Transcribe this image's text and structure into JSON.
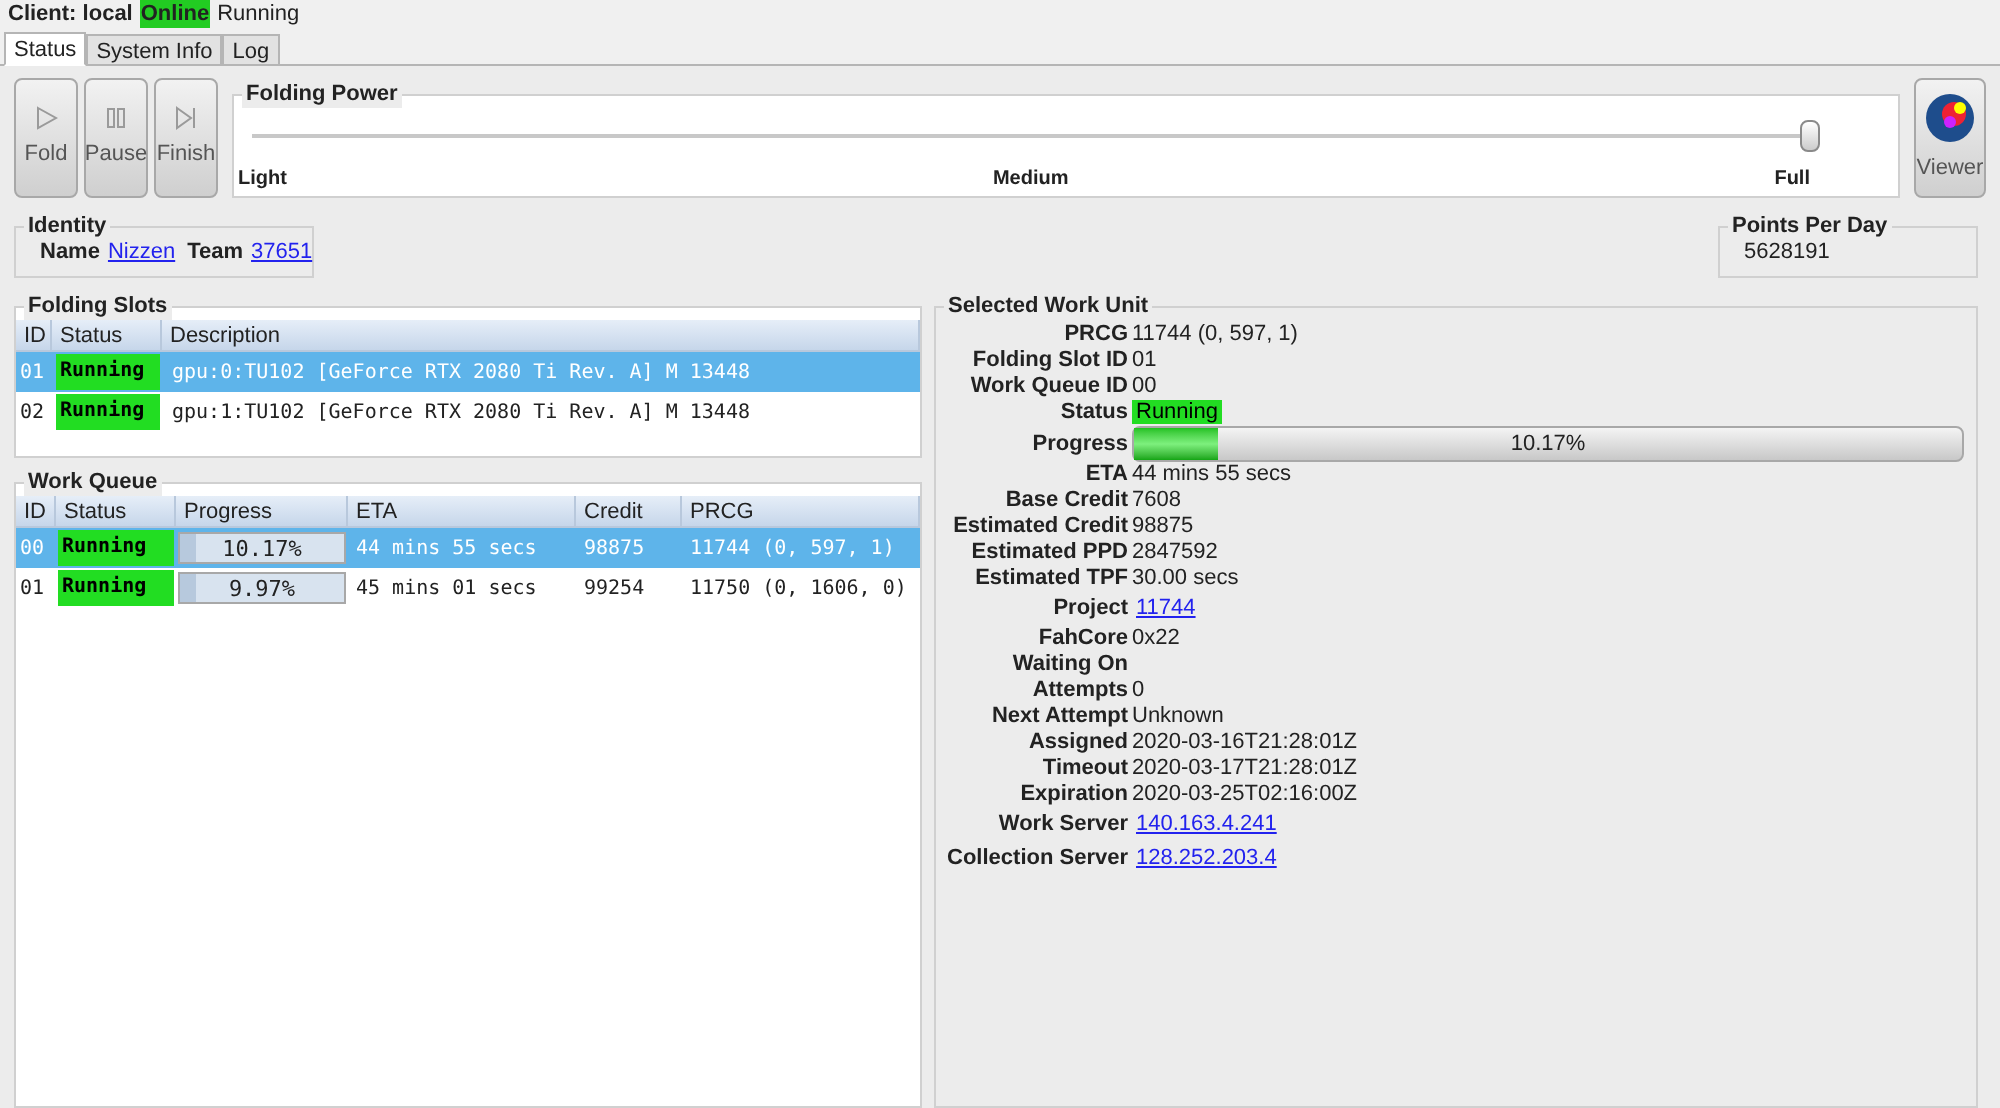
{
  "client": {
    "label": "Client:",
    "name": "local",
    "connection": "Online",
    "state": "Running"
  },
  "tabs": [
    {
      "label": "Status",
      "selected": true
    },
    {
      "label": "System Info",
      "selected": false
    },
    {
      "label": "Log",
      "selected": false
    }
  ],
  "controls": [
    {
      "kind": "fold",
      "label": "Fold"
    },
    {
      "kind": "pause",
      "label": "Pause"
    },
    {
      "kind": "finish",
      "label": "Finish"
    }
  ],
  "folding_power": {
    "title": "Folding Power",
    "level": 1,
    "marks": [
      "Light",
      "Medium",
      "Full"
    ]
  },
  "viewer": {
    "label": "Viewer"
  },
  "identity": {
    "title": "Identity",
    "name_label": "Name",
    "name": "Nizzen",
    "team_label": "Team",
    "team": "37651"
  },
  "points_per_day": {
    "title": "Points Per Day",
    "value": "5628191"
  },
  "folding_slots": {
    "title": "Folding Slots",
    "columns": [
      "ID",
      "Status",
      "Description"
    ],
    "rows": [
      {
        "id": "01",
        "status": "Running",
        "description": "gpu:0:TU102 [GeForce RTX 2080 Ti Rev. A] M 13448",
        "selected": true
      },
      {
        "id": "02",
        "status": "Running",
        "description": "gpu:1:TU102 [GeForce RTX 2080 Ti Rev. A] M 13448",
        "selected": false
      }
    ]
  },
  "work_queue": {
    "title": "Work Queue",
    "columns": [
      "ID",
      "Status",
      "Progress",
      "ETA",
      "Credit",
      "PRCG"
    ],
    "rows": [
      {
        "id": "00",
        "status": "Running",
        "progress": "10.17%",
        "level": 0.1017,
        "eta": "44 mins 55 secs",
        "credit": "98875",
        "prcg": "11744 (0, 597, 1)",
        "selected": true
      },
      {
        "id": "01",
        "status": "Running",
        "progress": "9.97%",
        "level": 0.0997,
        "eta": "45 mins 01 secs",
        "credit": "99254",
        "prcg": "11750 (0, 1606, 0)",
        "selected": false
      }
    ]
  },
  "selected_work_unit": {
    "title": "Selected Work Unit",
    "fields": [
      {
        "kind": "text",
        "label": "PRCG",
        "value": "11744 (0, 597, 1)"
      },
      {
        "kind": "text",
        "label": "Folding Slot ID",
        "value": "01"
      },
      {
        "kind": "text",
        "label": "Work Queue ID",
        "value": "00"
      },
      {
        "kind": "status",
        "label": "Status",
        "value": "Running"
      },
      {
        "kind": "progress",
        "label": "Progress",
        "value": "10.17%",
        "level": 0.1017
      },
      {
        "kind": "text",
        "label": "ETA",
        "value": "44 mins 55 secs"
      },
      {
        "kind": "text",
        "label": "Base Credit",
        "value": "7608"
      },
      {
        "kind": "text",
        "label": "Estimated Credit",
        "value": "98875"
      },
      {
        "kind": "text",
        "label": "Estimated PPD",
        "value": "2847592"
      },
      {
        "kind": "text",
        "label": "Estimated TPF",
        "value": "30.00 secs"
      },
      {
        "kind": "link",
        "label": "Project",
        "value": "11744"
      },
      {
        "kind": "text",
        "label": "FahCore",
        "value": "0x22"
      },
      {
        "kind": "text",
        "label": "Waiting On"
      },
      {
        "kind": "text",
        "label": "Attempts",
        "value": "0"
      },
      {
        "kind": "text",
        "label": "Next Attempt",
        "value": "Unknown"
      },
      {
        "kind": "text",
        "label": "Assigned",
        "value": "2020-03-16T21:28:01Z"
      },
      {
        "kind": "text",
        "label": "Timeout",
        "value": "2020-03-17T21:28:01Z"
      },
      {
        "kind": "text",
        "label": "Expiration",
        "value": "2020-03-25T02:16:00Z"
      },
      {
        "kind": "link",
        "label": "Work Server",
        "value": "140.163.4.241"
      },
      {
        "kind": "link",
        "label": "Collection Server",
        "value": "128.252.203.4"
      }
    ]
  }
}
